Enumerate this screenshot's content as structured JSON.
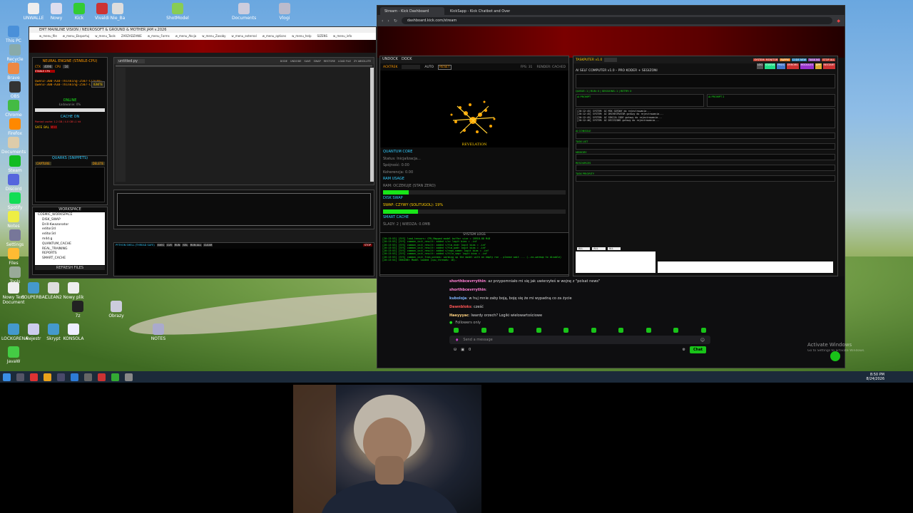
{
  "desktop": {
    "icons_left": [
      "This PC",
      "Recycle Bin",
      "Brave",
      "OBS",
      "Chrome",
      "Firefox",
      "Documents",
      "Steam",
      "Discord",
      "Spotify",
      "Notes",
      "Settings",
      "Files",
      "Tools"
    ],
    "icons_top": [
      "UNWALLE",
      "Nowy",
      "Kick",
      "Vivaldi",
      "Nie_Ba",
      "ShotModel",
      "Documents",
      "Vlogi"
    ],
    "icons_bottom": [
      "Nowy Text Document",
      "SOUPERBAL",
      "CLEAN2",
      "Nowy plik",
      "7z",
      "Obrazy",
      "LOCKGRENA",
      "Rejestr",
      "Skrypt",
      "KONSOLA",
      "NOTES",
      "JavaW"
    ],
    "activate_windows": "Activate Windows",
    "activate_windows_sub": "Go to Settings to activate Windows.",
    "clock_time": "8:50 PM",
    "clock_date": "8/24/2026"
  },
  "ide": {
    "window_title": "EMT MAINLINE VISION / NEUROSOFT & GROUND & MOTHER JAM v.2026",
    "menu": [
      "w_menu_file",
      "w_menu_Eksportuj",
      "w_menu_Tools",
      "ZARZADZANIE",
      "w_menu_Forms",
      "w_menu_Akcja",
      "w_menu_Zasoby",
      "w_menu_external",
      "w_menu_options",
      "w_menu_help",
      "SIZENS",
      "w_menu_info"
    ],
    "neural_engine": {
      "title": "NEURAL ENGINE (STABLE-CPU)",
      "ctx_label": "CTX",
      "ctx_value": "4096",
      "cpu_label": "CPU",
      "cpu_value": "16",
      "ignite": "IGNITE",
      "stable": "STABLE CPU",
      "models": [
        "Qwen3-30B-A3B-Thinking-2507-Claude-",
        "Qwen3-30B-A3B-Thinking-2507-Claude-"
      ],
      "status_online": "ONLINE",
      "loading": "Ładowanie: 0%",
      "cache_on": "CACHE ON",
      "cache_info": "Pamięć cache: 1.2 GB / 4.0 GB  L1 hit",
      "modes": [
        "SAFE",
        "BAL",
        "MAX"
      ]
    },
    "quarks": {
      "title": "QUARKS (SNIPPETS)",
      "capture": "CAPTURE",
      "delete": "DELETE"
    },
    "workspace": {
      "title": "WORKSPACE",
      "tree": [
        "COSMIC_WORKSPACE",
        "DISK_SWAP",
        "Drill-Kwazonator",
        "editor2d",
        "editor3d",
        "m4d.g",
        "QUANTUM_CACHE",
        "REAL_TRAINING",
        "REPORTS",
        "SMART_CACHE"
      ],
      "refresh": "REFRESH FILES"
    },
    "editor": {
      "filename": "untitled.py",
      "actions": [
        "DODE",
        "UNDODE",
        "SAVE",
        "SWAP",
        "RESTORE",
        "LOAD FILE",
        "ZY ABSOLUTE"
      ]
    },
    "shell": {
      "title": "PYTHON SHELL (THREAD SAFE)",
      "buttons": [
        "EXEC",
        "CLR",
        "RUN",
        "SEL",
        "RUN ALL",
        "CLEAR"
      ],
      "stop": "STOP"
    }
  },
  "visual": {
    "undock": "UNDOCK",
    "dock": "DOCK",
    "activate_label": "ACKTREK",
    "auto": "AUTO",
    "reset": "RESET",
    "fps": "FPS: 31",
    "render": "RENDER: CACHED",
    "revelation": "REVELATION",
    "quantum_core": "QUANTUM CORE",
    "status": "Status: Inicjalizacja...",
    "spojnosc": "Spójność: 0.00",
    "koherencja": "Koherencja: 0.00",
    "ram_title": "RAM USAGE",
    "ram_value": "RAM: OCZEKUJE (STAN ZERO)",
    "ram_fill": 0.14,
    "disk_title": "DISK SWAP",
    "disk_value": "SWAP: CZYWY (SOLITUGOL): 19%",
    "disk_fill": 0.19,
    "smart_cache": "SMART CACHE",
    "slady": "ŚLADY: 2 | WIEDZA: 0.0MB",
    "system_logs_title": "SYSTEM LOGS",
    "logs": [
      "[20:13:53] [SYS] load_tensors: CPU_Mapped model buffer size = 18918.88 MiB",
      "[20:13:53] [SYS] common_init_result: added </s> logit bias = -inf",
      "[20:13:53] [SYS] common_init_result: added </fim_end> logit bias = -inf",
      "[20:13:53] [SYS] common_init_result: added </fim_pad> logit bias = -inf",
      "[20:13:53] [SYS] common_init_result: added </repo_name> logit bias = -inf",
      "[20:13:53] [SYS] common_init_result: added </file_sep> logit bias = -inf",
      "[20:13:53] [SYS] common_init_from_params: warming up the model with an empty run - please wait ... (--no-warmup to disable)",
      "[20:13:54] <ENGINE> Model loaded (cpu_threads: 16)."
    ]
  },
  "taskputer": {
    "title": "TASKPUTER v1.0",
    "badges": [
      "SYSTEM: MONITOR",
      "RAPPIE",
      "CODE NEW",
      "TASK NG",
      "STOP ALL"
    ],
    "sub_badges": [
      "LOG",
      "STATUS",
      "PROC",
      "ERRORS",
      "MODULES",
      "APP",
      "RESTART"
    ],
    "subtitle": "AI SELF COMPUTER v1.0 – PRO KODER + SEGIZONI",
    "columns": [
      "AI PROMPT",
      "AI PROMPT 2"
    ],
    "status_line": "QUEUE: 1 | RUN: 0 | SESSIONS: 1 | RETRY: 0",
    "log_lines": [
      "[20:12:45] SYSTEM: AI MSK GOTOWY do rejestrowania...",
      "[20:12:45] SYSTEM: AI ORCHESTRATOR gotowy do rejestrowania...",
      "[20:12:45] SYSTEM: AI SEKCJA CODE gotowy do rejestrowania...",
      "[20:12:46] SYSTEM: AI DECISIONS gotowy do rejestrowania..."
    ],
    "sections": [
      "AI CONSOLE",
      "TASK LIST",
      "MEMORY",
      "RESOURCES",
      "TASK PRIORITY"
    ],
    "filters": [
      "ALL",
      "ALL",
      "ALL"
    ]
  },
  "browser": {
    "tabs": [
      "Stream - Kick Dashboard",
      "KickSapp - Kick Chatbot and Over..."
    ],
    "url": "dashboard.kick.com/stream"
  },
  "chat": {
    "messages": [
      {
        "user": "shorthbcevrrythin",
        "text": "az przypomniało mi się jak uwierzyłeś w wojnę z \"polsat news\""
      },
      {
        "user": "shorthbcevrrythin",
        "text": ""
      },
      {
        "user": "kuboloja",
        "text": "w huj mnie zaby boją, boję się że mi wypadną co za życie"
      },
      {
        "user": "Dawnbloks",
        "text": "cześć"
      },
      {
        "user": "Haeyyyac",
        "text": "Iwardy orzech? Logiki wielowartościowe"
      }
    ],
    "followers_only": "Followers only",
    "placeholder": "Send a message",
    "chat_button": "Chat",
    "count": "0"
  }
}
